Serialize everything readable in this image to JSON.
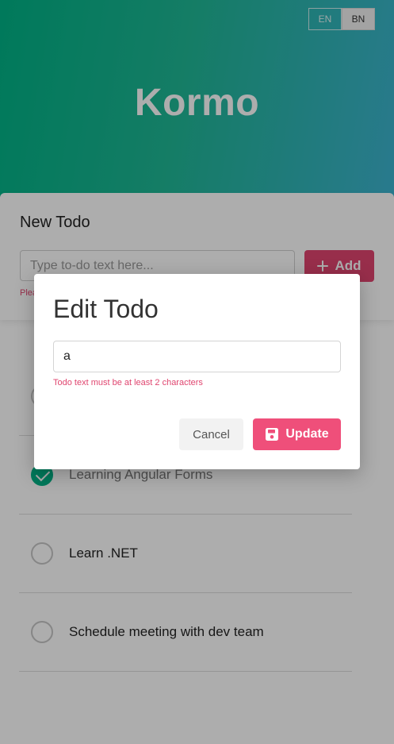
{
  "header": {
    "title": "Kormo",
    "languages": [
      {
        "code": "EN",
        "active": false
      },
      {
        "code": "BN",
        "active": true
      }
    ]
  },
  "new_todo": {
    "heading": "New Todo",
    "placeholder": "Type to-do text here...",
    "add_label": "Add",
    "error_partial": "Plea"
  },
  "todos": [
    {
      "text": "Learning Angular Forms",
      "done": true
    },
    {
      "text": "Learn .NET",
      "done": false
    },
    {
      "text": "Schedule meeting with dev team",
      "done": false
    }
  ],
  "modal": {
    "title": "Edit Todo",
    "input_value": "a",
    "error": "Todo text must be at least 2 characters",
    "cancel_label": "Cancel",
    "update_label": "Update"
  },
  "colors": {
    "brand_green": "#00b386",
    "accent_pink": "#ef4f7a",
    "error_text": "#e0456f"
  }
}
